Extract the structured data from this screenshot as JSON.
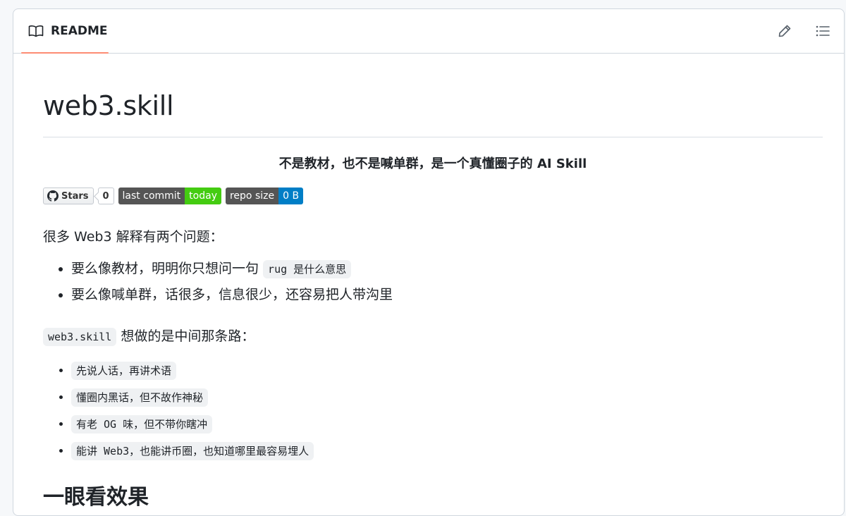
{
  "header": {
    "tab_label": "README",
    "icons": [
      "book-icon",
      "pencil-icon",
      "list-icon"
    ],
    "accent_color": "#fd8c73"
  },
  "readme": {
    "title": "web3.skill",
    "tagline": "不是教材，也不是喊单群，是一个真懂圈子的 AI Skill",
    "badges": {
      "stars_label": "Stars",
      "stars_count": "0",
      "commit_label": "last commit",
      "commit_value": "today",
      "size_label": "repo size",
      "size_value": "0 B"
    },
    "intro": "很多 Web3 解释有两个问题：",
    "problems": {
      "item1_text": "要么像教材，明明你只想问一句 ",
      "item1_code": "rug 是什么意思",
      "item2_text": "要么像喊单群，话很多，信息很少，还容易把人带沟里"
    },
    "path_code": "web3.skill",
    "path_text": " 想做的是中间那条路：",
    "principles": [
      "先说人话，再讲术语",
      "懂圈内黑话，但不故作神秘",
      "有老 OG 味，但不带你瞎冲",
      "能讲 Web3，也能讲币圈，也知道哪里最容易埋人"
    ],
    "section_heading": "一眼看效果"
  }
}
